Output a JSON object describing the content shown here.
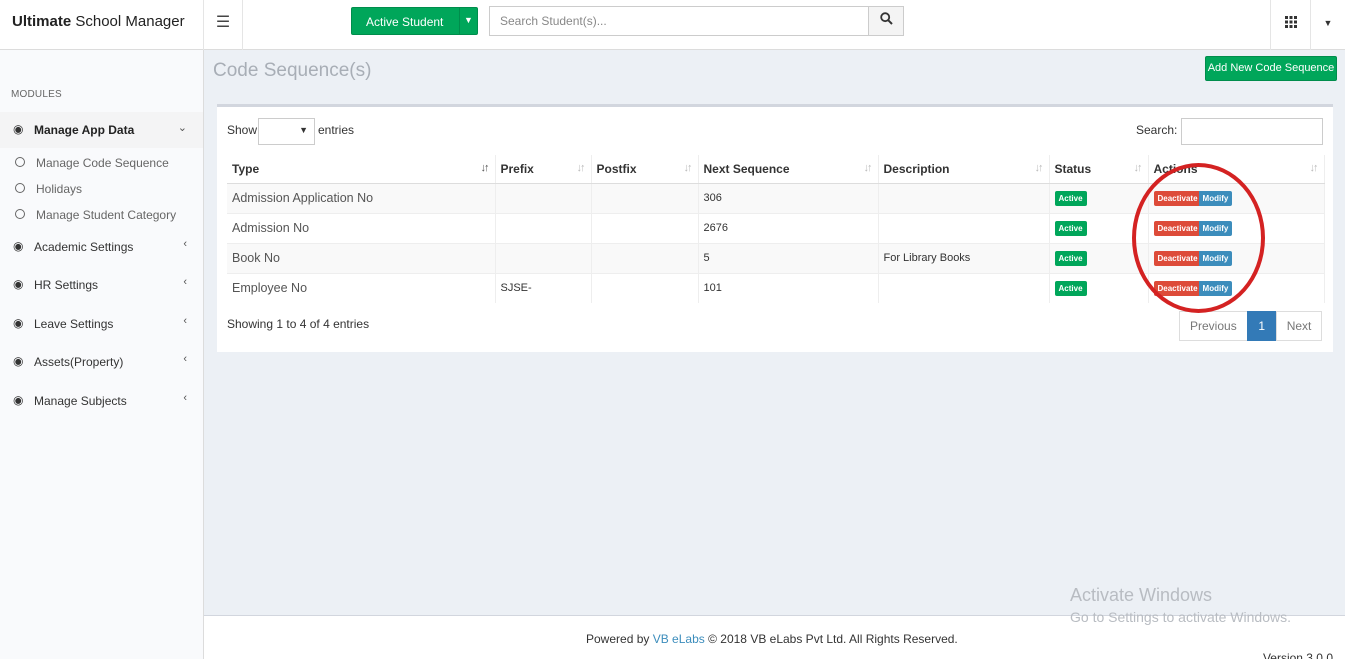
{
  "header": {
    "brand_bold": "Ultimate",
    "brand_rest": " School Manager",
    "menu_icon": "hamburger-icon",
    "student_filter_label": "Active Student",
    "search_placeholder": "Search Student(s)...",
    "search_icon": "search-icon",
    "apps_icon": "grid-icon"
  },
  "sidebar": {
    "heading": "MODULES",
    "groups": [
      {
        "label": "Manage App Data",
        "icon": "dashboard-icon",
        "arrow": "chevron-down-icon"
      },
      {
        "label": "Academic Settings",
        "icon": "dashboard-icon",
        "arrow": "chevron-left-icon"
      },
      {
        "label": "HR Settings",
        "icon": "dashboard-icon",
        "arrow": "chevron-left-icon"
      },
      {
        "label": "Leave Settings",
        "icon": "dashboard-icon",
        "arrow": "chevron-left-icon"
      },
      {
        "label": "Assets(Property)",
        "icon": "dashboard-icon",
        "arrow": "chevron-left-icon"
      },
      {
        "label": "Manage Subjects",
        "icon": "dashboard-icon",
        "arrow": "chevron-left-icon"
      }
    ],
    "sub_items": [
      {
        "label": "Manage Code Sequence"
      },
      {
        "label": "Holidays"
      },
      {
        "label": "Manage Student Category"
      }
    ]
  },
  "main": {
    "title": "Code Sequence(s)",
    "add_button": "Add New Code Sequence",
    "show_label": "Show",
    "entries_label": "entries",
    "search_label": "Search:",
    "columns": [
      "Type",
      "Prefix",
      "Postfix",
      "Next Sequence",
      "Description",
      "Status",
      "Actions"
    ],
    "rows": [
      {
        "type": "Admission Application No",
        "prefix": "",
        "postfix": "",
        "next": "306",
        "description": "",
        "status": "Active"
      },
      {
        "type": "Admission No",
        "prefix": "",
        "postfix": "",
        "next": "2676",
        "description": "",
        "status": "Active"
      },
      {
        "type": "Book No",
        "prefix": "",
        "postfix": "",
        "next": "5",
        "description": "For Library Books",
        "status": "Active"
      },
      {
        "type": "Employee No",
        "prefix": "SJSE-",
        "postfix": "",
        "next": "101",
        "description": "",
        "status": "Active"
      }
    ],
    "deactivate_label": "Deactivate",
    "modify_label": "Modify",
    "showing_text": "Showing 1 to 4 of 4 entries",
    "pagination": {
      "previous": "Previous",
      "current": "1",
      "next": "Next"
    }
  },
  "overlay": {
    "watermark_title": "Activate Windows",
    "watermark_sub": "Go to Settings to activate Windows."
  },
  "footer": {
    "powered_by": "Powered by",
    "company_link": "VB eLabs",
    "copyright": "© 2018 VB eLabs Pvt Ltd. All Rights Reserved.",
    "version": "Version 3.0.0"
  },
  "colors": {
    "green": "#00a65a",
    "red": "#dd4b39",
    "blue": "#3c8dbc",
    "highlight": "#d42222"
  }
}
